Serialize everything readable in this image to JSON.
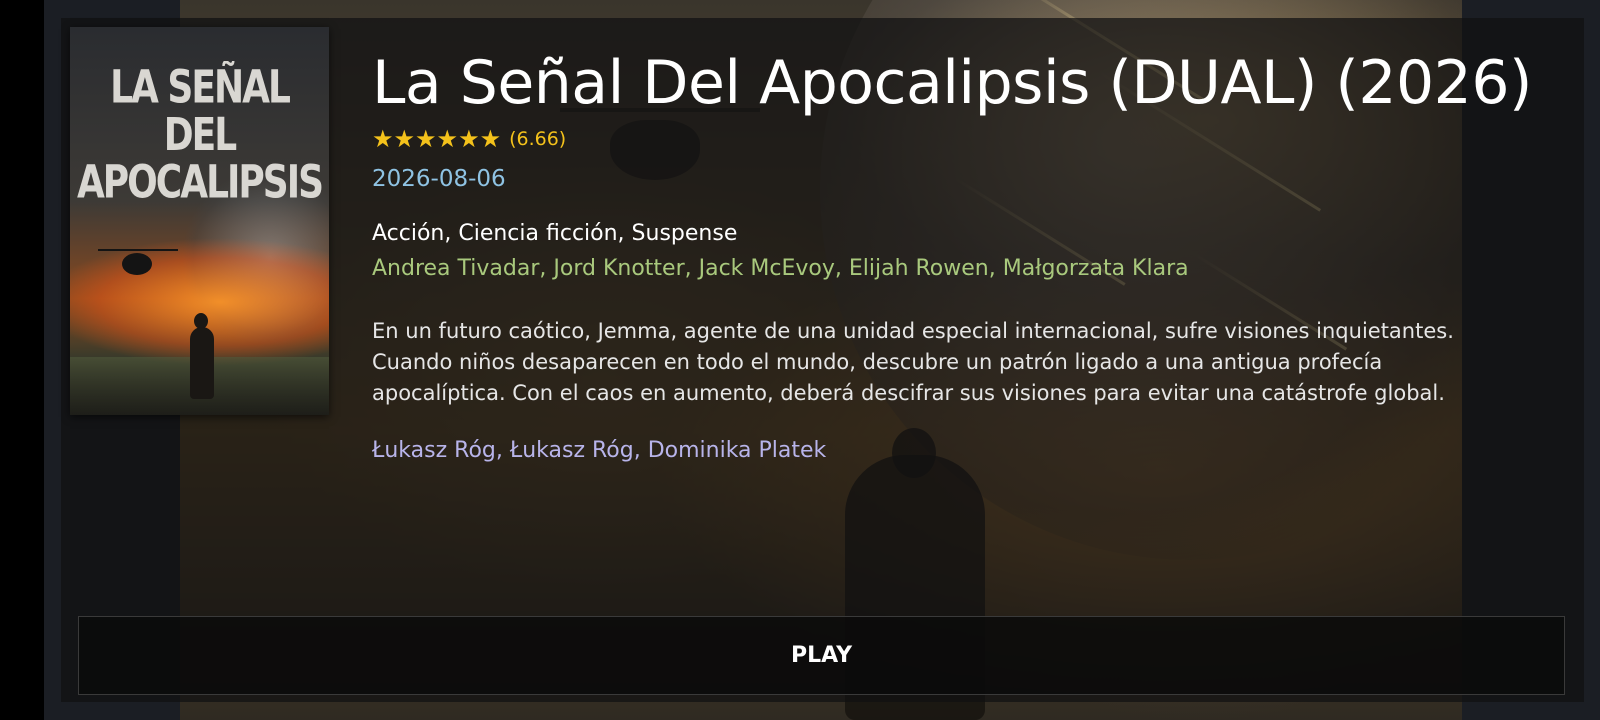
{
  "movie": {
    "poster_title": "LA SEÑAL DEL APOCALIPSIS",
    "title": "La Señal Del Apocalipsis (DUAL) (2026)",
    "stars": "★★★★★★",
    "rating": "(6.66)",
    "release_date": "2026-08-06",
    "genres": "Acción, Ciencia ficción, Suspense",
    "cast": "Andrea Tivadar, Jord Knotter, Jack McEvoy, Elijah Rowen, Małgorzata Klara",
    "overview_lines": [
      "En un futuro caótico, Jemma, agente de una unidad especial internacional, sufre visiones inquietantes.",
      "Cuando niños desaparecen en todo el mundo, descubre un patrón ligado a una antigua profecía",
      "apocalíptica. Con el caos en aumento, deberá descifrar sus visiones para evitar una catástrofe global."
    ],
    "crew": "Łukasz Róg, Łukasz Róg, Dominika Platek"
  },
  "actions": {
    "play_label": "PLAY"
  },
  "colors": {
    "rating": "#f4c21b",
    "date": "#8fc3e3",
    "cast": "#a9c97d",
    "crew": "#b8b4ea"
  }
}
